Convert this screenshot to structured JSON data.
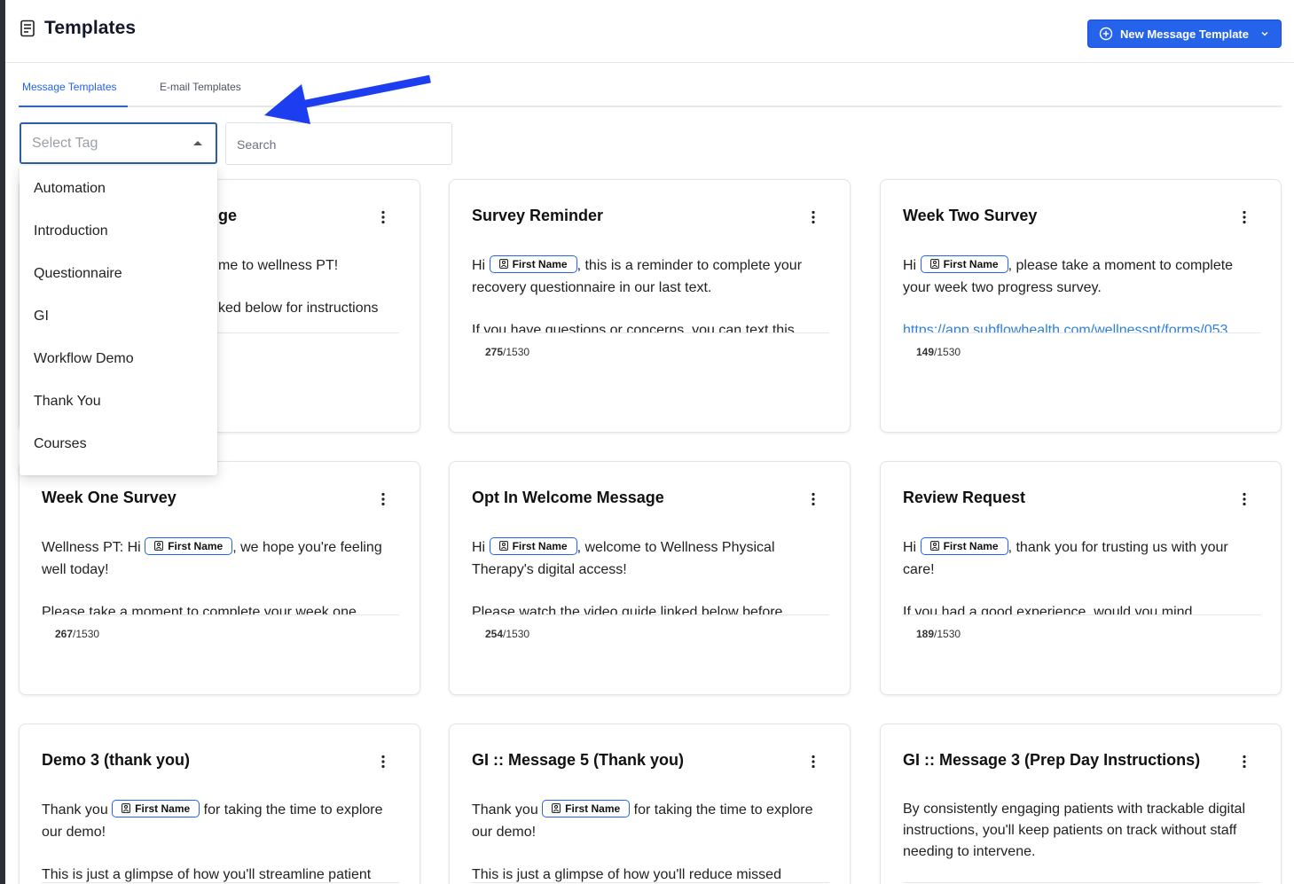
{
  "header": {
    "title": "Templates",
    "new_button_label": "New Message Template"
  },
  "tabs": [
    {
      "label": "Message Templates",
      "active": true
    },
    {
      "label": "E-mail Templates",
      "active": false
    }
  ],
  "filters": {
    "select_tag_placeholder": "Select Tag",
    "search_placeholder": "Search"
  },
  "dropdown_options": [
    "Automation",
    "Introduction",
    "Questionnaire",
    "GI",
    "Workflow Demo",
    "Thank You",
    "Courses"
  ],
  "chip_label": "First Name",
  "cards": [
    {
      "title_partial": "ge",
      "line1_partial": "me to wellness PT!",
      "line2_partial": "ked below for instructions"
    },
    {
      "title": "Survey Reminder",
      "pre": "Hi",
      "post": ", this is a reminder to complete your recovery questionnaire in our last text.",
      "para2": "If you have questions or concerns, you can text this",
      "count": "275",
      "max": "/1530"
    },
    {
      "title": "Week Two Survey",
      "pre": "Hi",
      "post": ", please take a moment to complete your week two progress survey.",
      "link": "https://app.subflowhealth.com/wellnesspt/forms/053",
      "count": "149",
      "max": "/1530"
    },
    {
      "title": "Week One Survey",
      "pre": "Wellness PT: Hi",
      "post": ", we hope you're feeling well today!",
      "para2": "Please take a moment to complete your week one",
      "count": "267",
      "max": "/1530"
    },
    {
      "title": "Opt In Welcome Message",
      "pre": "Hi",
      "post": ", welcome to Wellness Physical Therapy's digital access!",
      "para2": "Please watch the video guide linked below before",
      "count": "254",
      "max": "/1530"
    },
    {
      "title": "Review Request",
      "pre": "Hi",
      "post": ", thank you for trusting us with your care!",
      "para2": "If you had a good experience, would you mind",
      "count": "189",
      "max": "/1530"
    },
    {
      "title": "Demo 3 (thank you)",
      "pre": "Thank you",
      "post": " for taking the time to explore our demo!",
      "para2": "This is just a glimpse of how you'll streamline patient"
    },
    {
      "title": "GI :: Message 5 (Thank you)",
      "pre": "Thank you",
      "post": " for taking the time to explore our demo!",
      "para2": "This is just a glimpse of how you'll reduce missed"
    },
    {
      "title": "GI :: Message 3 (Prep Day Instructions)",
      "text": "By consistently engaging patients with trackable digital instructions, you'll keep patients on track without staff needing to intervene."
    }
  ],
  "colors": {
    "accent": "#2563eb",
    "select_border": "#2c5ea8",
    "arrow": "#1d3df0",
    "link": "#2f7fd9"
  }
}
